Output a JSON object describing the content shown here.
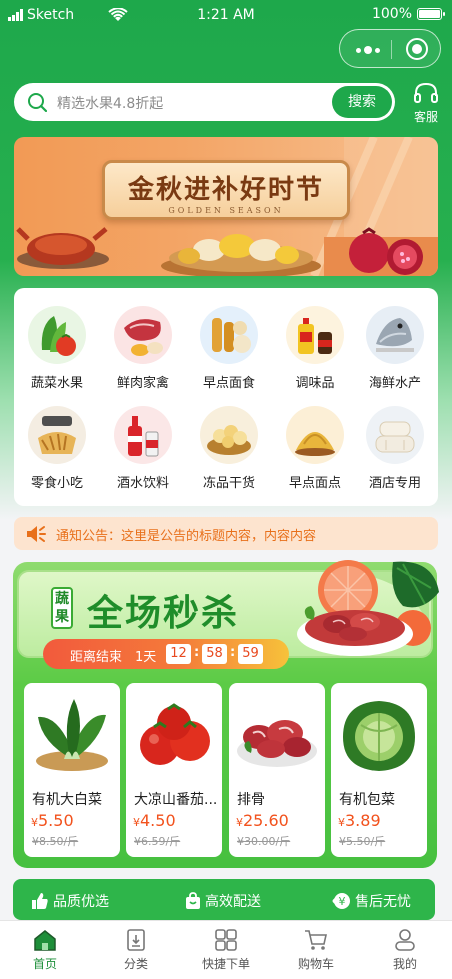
{
  "status_bar": {
    "carrier": "Sketch",
    "time": "1:21 AM",
    "battery": "100%"
  },
  "search": {
    "placeholder": "精选水果4.8折起",
    "button_label": "搜索"
  },
  "service": {
    "label": "客服"
  },
  "banner": {
    "title": "金秋进补好时节",
    "subtitle": "GOLDEN SEASON"
  },
  "categories": [
    {
      "label": "蔬菜水果",
      "icon": "vegetables-fruit-icon"
    },
    {
      "label": "鲜肉家禽",
      "icon": "meat-icon"
    },
    {
      "label": "早点面食",
      "icon": "breakfast-icon"
    },
    {
      "label": "调味品",
      "icon": "condiment-icon"
    },
    {
      "label": "海鲜水产",
      "icon": "seafood-icon"
    },
    {
      "label": "零食小吃",
      "icon": "snack-icon"
    },
    {
      "label": "酒水饮料",
      "icon": "drinks-icon"
    },
    {
      "label": "冻品干货",
      "icon": "frozen-dry-icon"
    },
    {
      "label": "早点面点",
      "icon": "pastry-icon"
    },
    {
      "label": "酒店专用",
      "icon": "hotel-supplies-icon"
    }
  ],
  "notice": {
    "prefix": "通知公告：",
    "text": "这里是公告的标题内容，内容内容"
  },
  "flash_sale": {
    "tag_line1": "蔬",
    "tag_line2": "果",
    "title": "全场秒杀",
    "countdown_label": "距离结束",
    "days": "1天",
    "hours": "12",
    "minutes": "58",
    "seconds": "59",
    "products": [
      {
        "name": "有机大白菜",
        "currency": "¥",
        "price": "5.50",
        "old_price": "¥8.50/斤"
      },
      {
        "name": "大凉山番茄...",
        "currency": "¥",
        "price": "4.50",
        "old_price": "¥6.59/斤"
      },
      {
        "name": "排骨",
        "currency": "¥",
        "price": "25.60",
        "old_price": "¥30.00/斤"
      },
      {
        "name": "有机包菜",
        "currency": "¥",
        "price": "3.89",
        "old_price": "¥5.50/斤"
      }
    ]
  },
  "guarantees": [
    {
      "label": "品质优选",
      "icon": "thumbs-up-icon"
    },
    {
      "label": "高效配送",
      "icon": "bag-icon"
    },
    {
      "label": "售后无忧",
      "icon": "yuan-return-icon"
    }
  ],
  "tabbar": [
    {
      "label": "首页",
      "icon": "home-icon",
      "active": true
    },
    {
      "label": "分类",
      "icon": "category-icon",
      "active": false
    },
    {
      "label": "快捷下单",
      "icon": "quick-order-icon",
      "active": false
    },
    {
      "label": "购物车",
      "icon": "cart-icon",
      "active": false
    },
    {
      "label": "我的",
      "icon": "profile-icon",
      "active": false
    }
  ],
  "colors": {
    "brand_green": "#1ea84b",
    "price_red": "#f2521d",
    "notice_orange": "#e8701b"
  }
}
